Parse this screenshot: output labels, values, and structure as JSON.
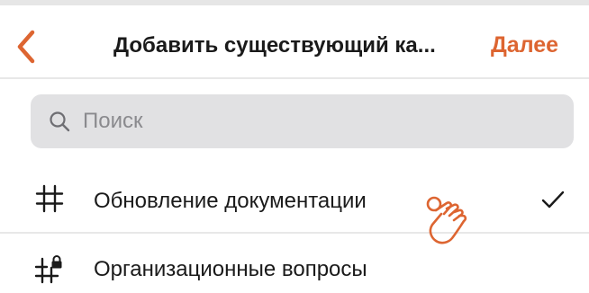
{
  "colors": {
    "accent": "#dd6531",
    "text": "#1a1a1a",
    "placeholder": "#8a8a8e",
    "search_bg": "#e1e1e3",
    "divider": "#e8e8e8"
  },
  "header": {
    "back_icon": "chevron-left-icon",
    "title": "Добавить существующий ка...",
    "next_label": "Далее"
  },
  "search": {
    "icon": "search-icon",
    "placeholder": "Поиск",
    "value": ""
  },
  "channels": [
    {
      "icon": "hash-icon",
      "name": "Обновление документации",
      "selected": true
    },
    {
      "icon": "hash-lock-icon",
      "name": "Организационные вопросы",
      "selected": false
    }
  ],
  "overlay": {
    "icon": "hand-pointer-icon"
  }
}
